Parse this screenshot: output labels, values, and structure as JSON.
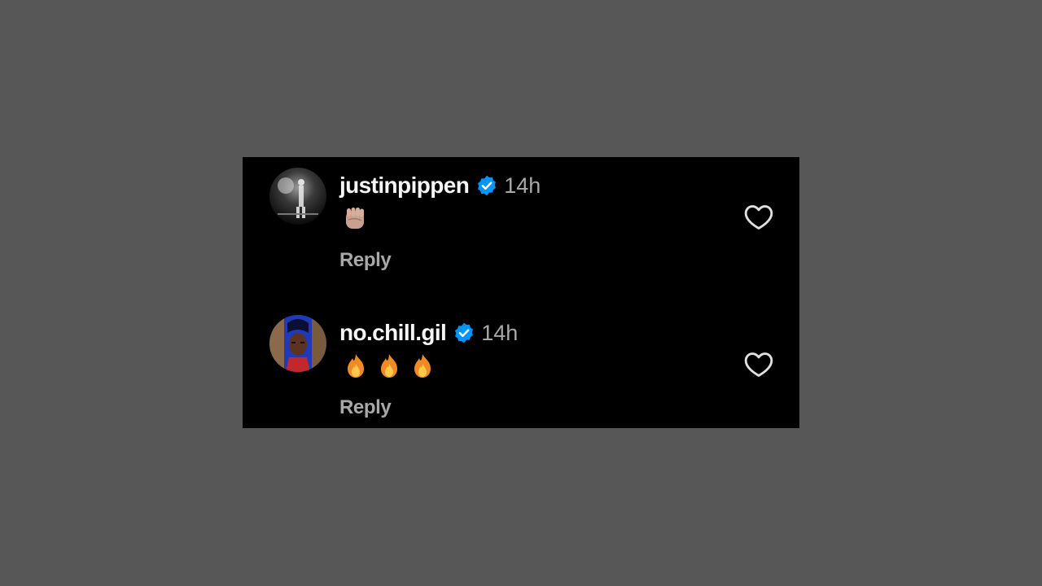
{
  "comments": [
    {
      "username": "justinpippen",
      "verified_icon": "verified-badge-icon",
      "time": "14h",
      "emoji": [
        "raised-fist"
      ],
      "reply_label": "Reply",
      "like_icon": "heart-outline-icon"
    },
    {
      "username": "no.chill.gil",
      "verified_icon": "verified-badge-icon",
      "time": "14h",
      "emoji": [
        "fire",
        "fire",
        "fire"
      ],
      "reply_label": "Reply",
      "like_icon": "heart-outline-icon"
    }
  ],
  "colors": {
    "page_background": "#575757",
    "panel_background": "#000000",
    "username": "#f5f5f5",
    "muted_text": "#a8a8a8",
    "verified_blue": "#0095f6"
  }
}
